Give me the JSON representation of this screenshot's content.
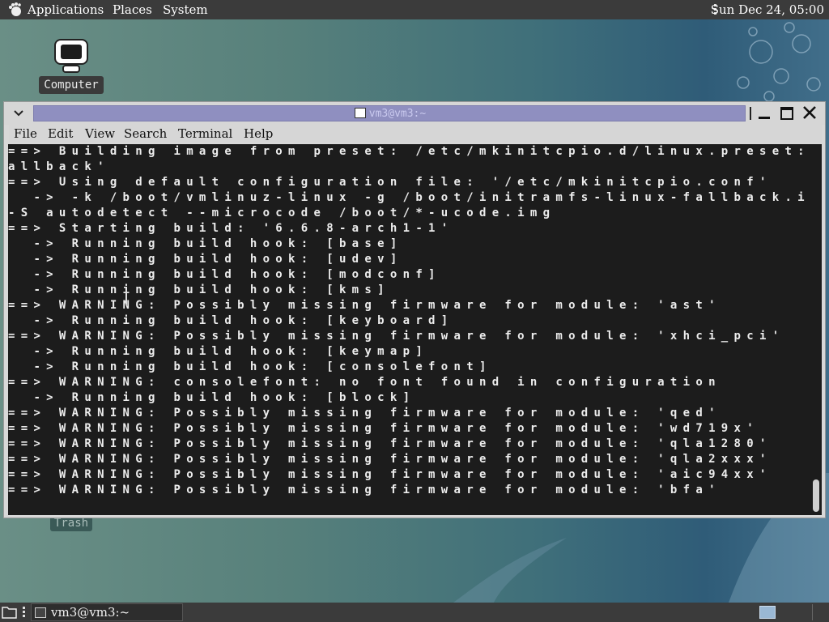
{
  "top_panel": {
    "menus": [
      "Applications",
      "Places",
      "System"
    ],
    "clock": "Sun Dec 24, 05:00",
    "logo_icon": "gnome-foot-icon"
  },
  "desktop": {
    "computer_label": "Computer",
    "trash_label": "Trash"
  },
  "window": {
    "title": "vm3@vm3:~",
    "menubar": [
      "File",
      "Edit",
      "View",
      "Search",
      "Terminal",
      "Help"
    ]
  },
  "terminal": {
    "lines": [
      "==> Building image from preset: /etc/mkinitcpio.d/linux.preset: 'f",
      "allback'",
      "==> Using default configuration file: '/etc/mkinitcpio.conf'",
      "  -> -k /boot/vmlinuz-linux -g /boot/initramfs-linux-fallback.img",
      "-S autodetect --microcode /boot/*-ucode.img",
      "==> Starting build: '6.6.8-arch1-1'",
      "  -> Running build hook: [base]",
      "  -> Running build hook: [udev]",
      "  -> Running build hook: [modconf]",
      "  -> Running build hook: [kms]",
      "==> WARNING: Possibly missing firmware for module: 'ast'",
      "  -> Running build hook: [keyboard]",
      "==> WARNING: Possibly missing firmware for module: 'xhci_pci'",
      "  -> Running build hook: [keymap]",
      "  -> Running build hook: [consolefont]",
      "==> WARNING: consolefont: no font found in configuration",
      "  -> Running build hook: [block]",
      "==> WARNING: Possibly missing firmware for module: 'qed'",
      "==> WARNING: Possibly missing firmware for module: 'wd719x'",
      "==> WARNING: Possibly missing firmware for module: 'qla1280'",
      "==> WARNING: Possibly missing firmware for module: 'qla2xxx'",
      "==> WARNING: Possibly missing firmware for module: 'aic94xx'",
      "==> WARNING: Possibly missing firmware for module: 'bfa'"
    ]
  },
  "taskbar": {
    "task_label": "vm3@vm3:~"
  },
  "colors": {
    "panel": "#3b3b3b",
    "terminal_bg": "#1c1c1c",
    "terminal_fg": "#ececec",
    "titlebar_active": "#8f8fc0"
  }
}
